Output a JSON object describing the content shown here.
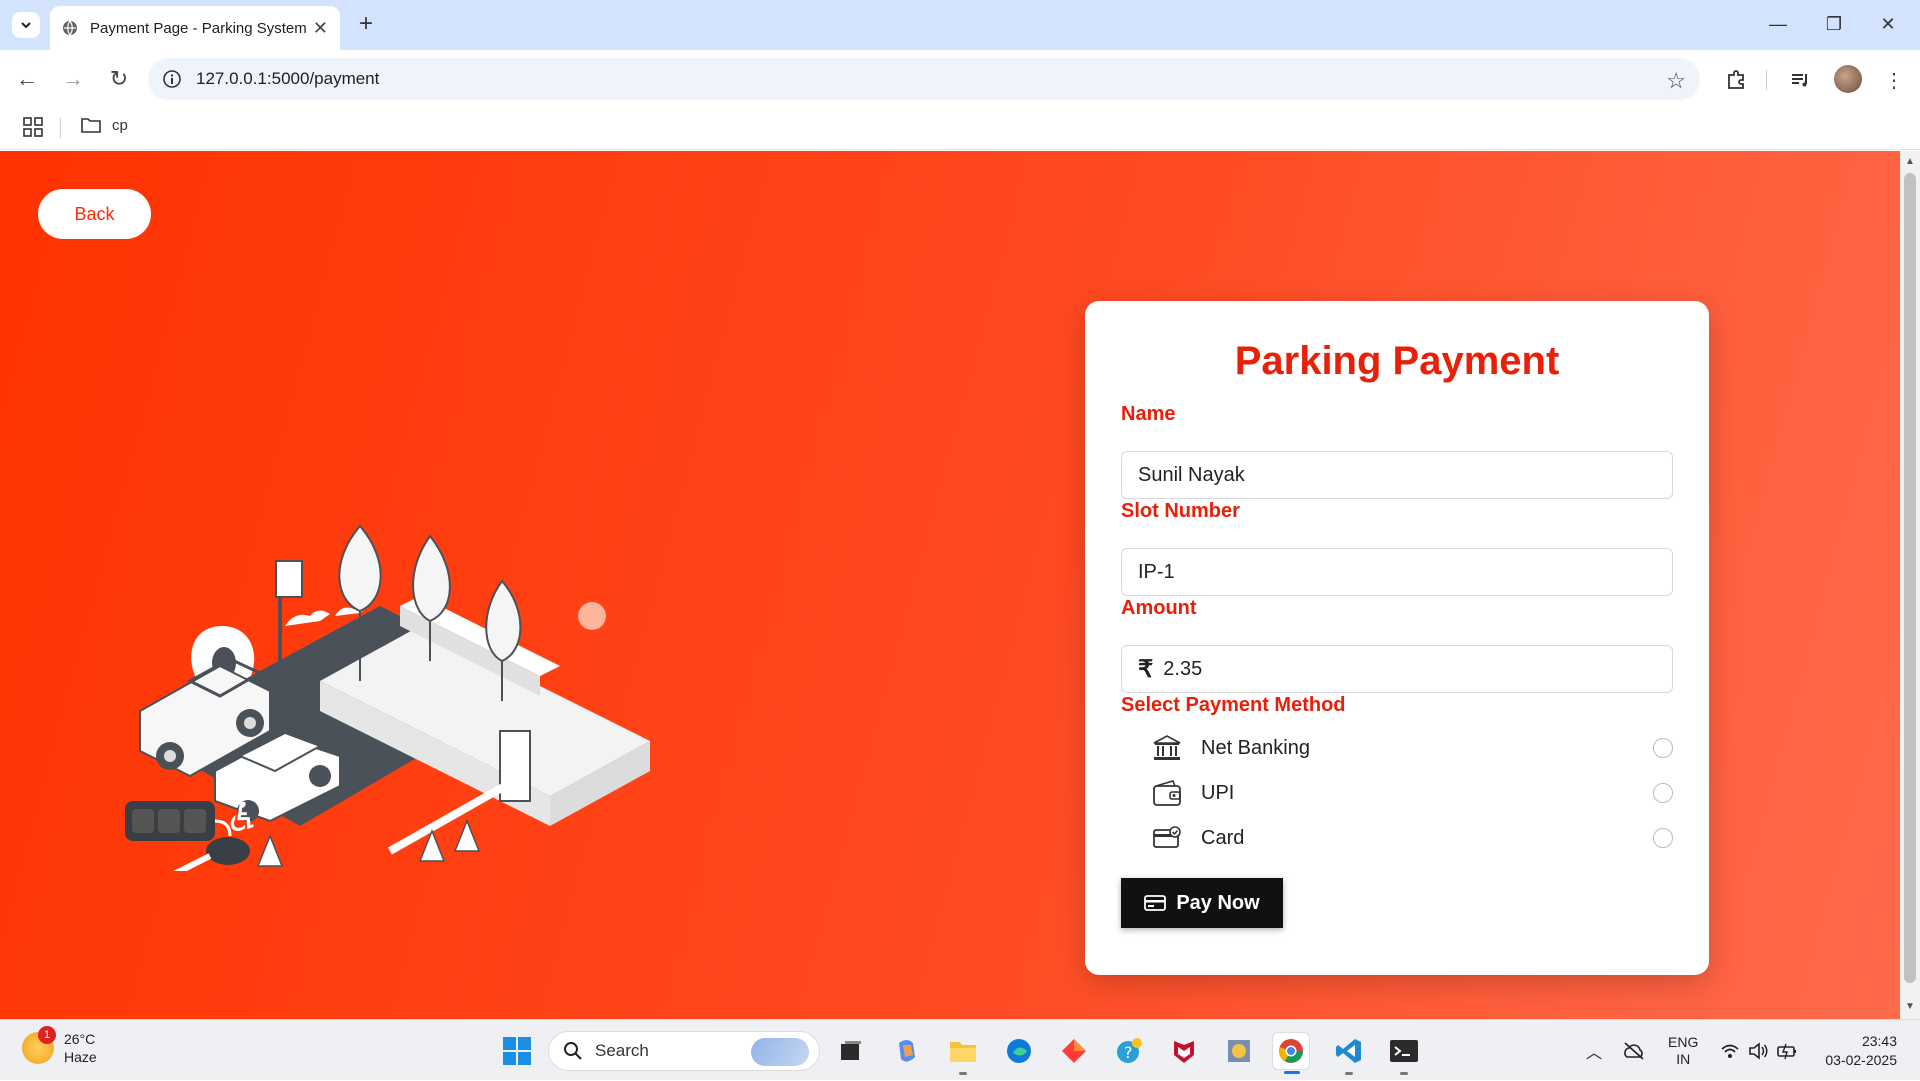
{
  "browser": {
    "tab_title": "Payment Page - Parking System",
    "url": "127.0.0.1:5000/payment",
    "bookmark_folder": "cp"
  },
  "page": {
    "back_label": "Back",
    "heading": "Parking Payment",
    "fields": {
      "name_label": "Name",
      "name_value": "Sunil Nayak",
      "slot_label": "Slot Number",
      "slot_value": "IP-1",
      "amount_label": "Amount",
      "amount_symbol": "₹",
      "amount_value": "2.35"
    },
    "payment": {
      "label": "Select Payment Method",
      "methods": [
        {
          "label": "Net Banking",
          "icon": "bank-icon",
          "selected": false
        },
        {
          "label": "UPI",
          "icon": "wallet-icon",
          "selected": false
        },
        {
          "label": "Card",
          "icon": "card-icon",
          "selected": false
        }
      ]
    },
    "pay_button": "Pay Now",
    "colors": {
      "accent": "#e8200a",
      "background": "#ff3300",
      "button": "#111111"
    }
  },
  "taskbar": {
    "weather_temp": "26°C",
    "weather_desc": "Haze",
    "weather_badge": "1",
    "search_placeholder": "Search",
    "lang_line1": "ENG",
    "lang_line2": "IN",
    "time": "23:43",
    "date": "03-02-2025"
  }
}
